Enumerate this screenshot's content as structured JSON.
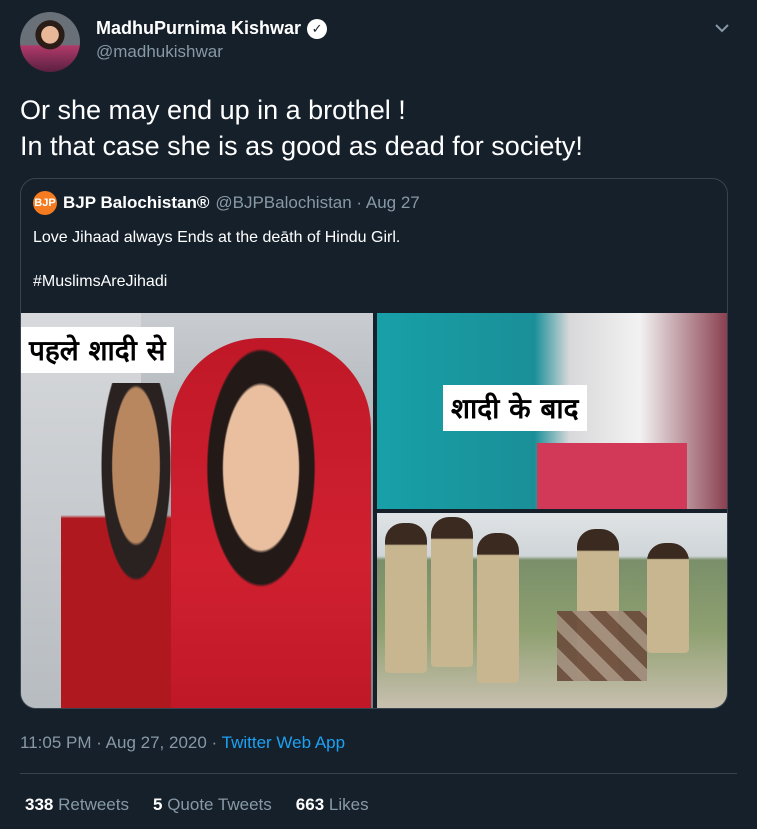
{
  "tweet": {
    "author": {
      "name": "MadhuPurnima Kishwar",
      "handle": "@madhukishwar",
      "verified_glyph": "✓"
    },
    "more_icon": "chevron-down-icon",
    "text_lines": [
      "Or she may end up in a brothel !",
      "In that case she is as good as dead for society!"
    ],
    "timestamp": "11:05 PM · Aug 27, 2020 · ",
    "source_app": "Twitter Web App",
    "stats": {
      "retweets_count": "338",
      "retweets_label": "Retweets",
      "quotes_count": "5",
      "quotes_label": "Quote Tweets",
      "likes_count": "663",
      "likes_label": "Likes"
    }
  },
  "quoted_tweet": {
    "author_name": "BJP Balochistan®",
    "handle_date": "@BJPBalochistan · Aug 27",
    "text": "Love Jihaad always Ends at the deāth of Hindu Girl.",
    "hashtag": "#MuslimsAreJihadi",
    "media": {
      "caption_before": "पहले शादी से",
      "caption_after": "शादी के बाद"
    }
  },
  "colors": {
    "background": "#15202b",
    "secondary_text": "#8899a6",
    "link": "#1da1f2",
    "border": "#38444d"
  }
}
